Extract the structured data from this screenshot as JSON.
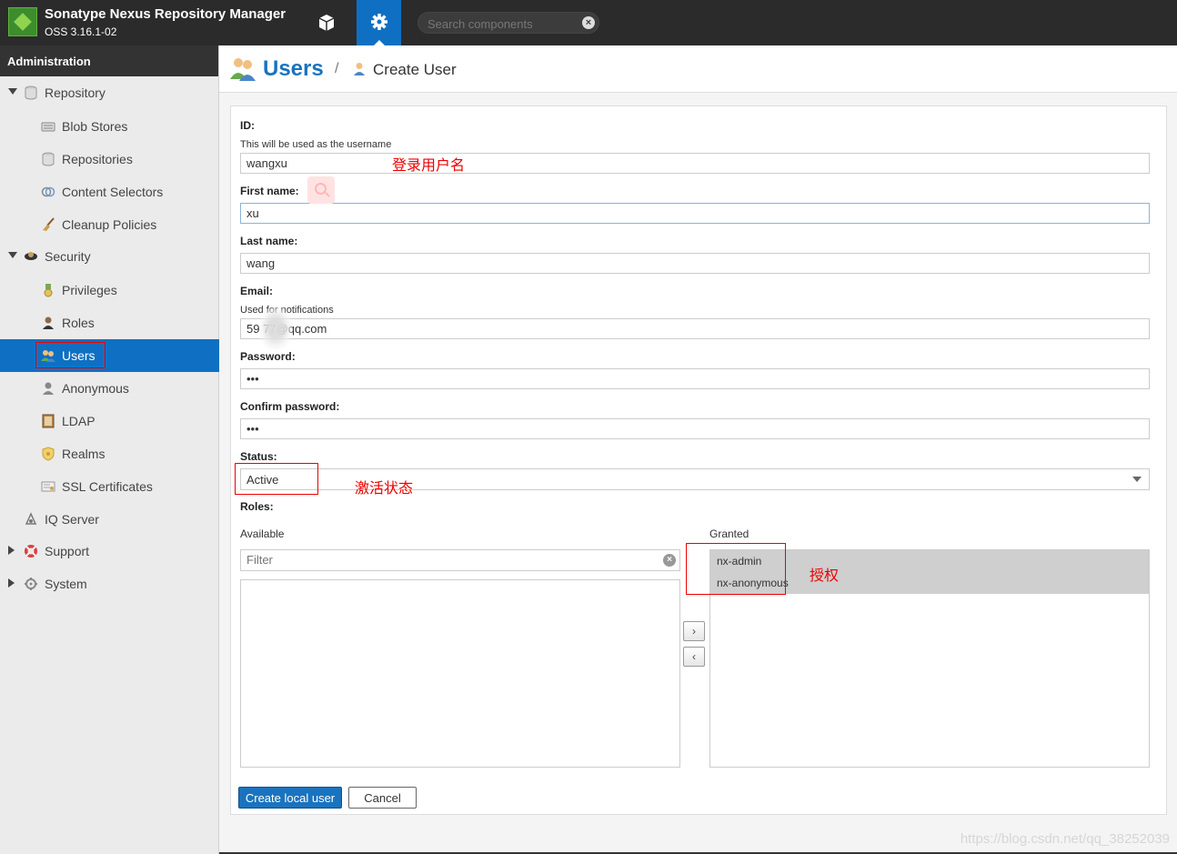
{
  "app": {
    "title": "Sonatype Nexus Repository Manager",
    "version": "OSS 3.16.1-02",
    "search_placeholder": "Search components"
  },
  "sidebar": {
    "header": "Administration",
    "items": [
      {
        "label": "Repository",
        "icon": "database-icon",
        "level": 1,
        "expanded": true
      },
      {
        "label": "Blob Stores",
        "icon": "blob-store-icon",
        "level": 2
      },
      {
        "label": "Repositories",
        "icon": "database-icon",
        "level": 2
      },
      {
        "label": "Content Selectors",
        "icon": "selector-icon",
        "level": 2
      },
      {
        "label": "Cleanup Policies",
        "icon": "broom-icon",
        "level": 2
      },
      {
        "label": "Security",
        "icon": "security-icon",
        "level": 1,
        "expanded": true
      },
      {
        "label": "Privileges",
        "icon": "medal-icon",
        "level": 2
      },
      {
        "label": "Roles",
        "icon": "role-icon",
        "level": 2
      },
      {
        "label": "Users",
        "icon": "users-icon",
        "level": 2,
        "selected": true
      },
      {
        "label": "Anonymous",
        "icon": "user-icon",
        "level": 2
      },
      {
        "label": "LDAP",
        "icon": "book-icon",
        "level": 2
      },
      {
        "label": "Realms",
        "icon": "shield-icon",
        "level": 2
      },
      {
        "label": "SSL Certificates",
        "icon": "certificate-icon",
        "level": 2
      },
      {
        "label": "IQ Server",
        "icon": "iq-icon",
        "level": 1
      },
      {
        "label": "Support",
        "icon": "lifebuoy-icon",
        "level": 1,
        "expanded": false
      },
      {
        "label": "System",
        "icon": "gear-icon",
        "level": 1,
        "expanded": false
      }
    ]
  },
  "page": {
    "title": "Users",
    "breadcrumb_sep": "/",
    "breadcrumb": "Create User"
  },
  "form": {
    "id_label": "ID:",
    "id_help": "This will be used as the username",
    "id_value": "wangxu",
    "first_label": "First name:",
    "first_value": "xu",
    "last_label": "Last name:",
    "last_value": "wang",
    "email_label": "Email:",
    "email_help": "Used for notifications",
    "email_value": "59 77@qq.com",
    "password_label": "Password:",
    "password_value": "•••",
    "confirm_label": "Confirm password:",
    "confirm_value": "•••",
    "status_label": "Status:",
    "status_value": "Active",
    "roles_label": "Roles:",
    "available_label": "Available",
    "filter_placeholder": "Filter",
    "granted_label": "Granted",
    "granted": [
      "nx-admin",
      "nx-anonymous"
    ],
    "move_right": "›",
    "move_left": "‹",
    "create_button": "Create local user",
    "cancel_button": "Cancel"
  },
  "annotations": {
    "id_note": "登录用户名",
    "status_note": "激活状态",
    "roles_note": "授权"
  },
  "watermark": "https://blog.csdn.net/qq_38252039",
  "colors": {
    "accent": "#0f70c3",
    "topbar": "#2b2b2b",
    "annotation": "#ee0000"
  }
}
